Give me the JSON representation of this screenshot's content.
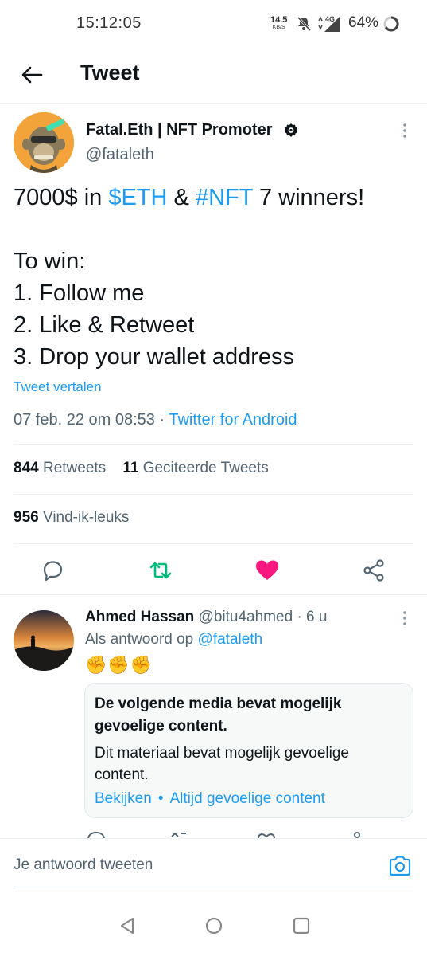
{
  "status_bar": {
    "time": "15:12:05",
    "net_speed": "14.5",
    "net_unit": "KB/S",
    "network": "4G",
    "battery": "64%"
  },
  "header": {
    "title": "Tweet"
  },
  "tweet": {
    "author_name": "Fatal.Eth | NFT Promoter",
    "author_handle": "@fataleth",
    "text_line1_a": "7000$ in ",
    "text_line1_link1": "$ETH",
    "text_line1_b": " & ",
    "text_line1_link2": "#NFT",
    "text_line1_c": " 7 winners!",
    "text_line2": "To win:",
    "text_line3": "1. Follow me",
    "text_line4": "2. Like & Retweet",
    "text_line5": "3. Drop your wallet address",
    "translate_label": "Tweet vertalen",
    "timestamp": "07 feb. 22 om 08:53",
    "separator": " · ",
    "source": "Twitter for Android",
    "retweets_count": "844",
    "retweets_label": "Retweets",
    "quotes_count": "11",
    "quotes_label": "Geciteerde Tweets",
    "likes_count": "956",
    "likes_label": "Vind-ik-leuks"
  },
  "actions": {
    "retweet_color": "#00ba7c",
    "like_color": "#f91880",
    "icons": [
      "reply-icon",
      "retweet-icon",
      "like-icon",
      "share-icon"
    ]
  },
  "reply": {
    "name": "Ahmed Hassan",
    "handle": "@bitu4ahmed",
    "time": "6 u",
    "reply_to_label": "Als antwoord op ",
    "reply_to_mention": "@fataleth",
    "emojis": "✊✊✊",
    "sensitive_title": "De volgende media bevat mogelijk gevoelige content.",
    "sensitive_body": "Dit materiaal bevat mogelijk gevoelige content.",
    "view_label": "Bekijken",
    "always_label": "Altijd gevoelige content"
  },
  "compose": {
    "placeholder": "Je antwoord tweeten"
  },
  "colors": {
    "accent": "#1d9bf0",
    "text_primary": "#0f1419",
    "text_secondary": "#536471"
  }
}
